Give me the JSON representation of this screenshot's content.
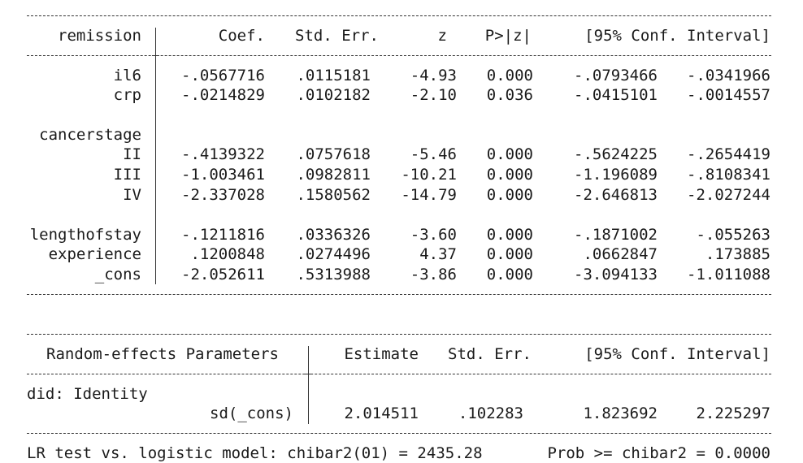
{
  "fixed": {
    "header": {
      "depvar": "remission",
      "coef": "Coef.",
      "se": "Std. Err.",
      "z": "z",
      "p": "P>|z|",
      "ci": "[95% Conf. Interval]"
    },
    "rows": [
      {
        "name": "il6",
        "coef": "-.0567716",
        "se": ".0115181",
        "z": "-4.93",
        "p": "0.000",
        "lo": "-.0793466",
        "hi": "-.0341966"
      },
      {
        "name": "crp",
        "coef": "-.0214829",
        "se": ".0102182",
        "z": "-2.10",
        "p": "0.036",
        "lo": "-.0415101",
        "hi": "-.0014557"
      },
      {
        "name": "cancerstage",
        "coef": "",
        "se": "",
        "z": "",
        "p": "",
        "lo": "",
        "hi": ""
      },
      {
        "name": "II",
        "coef": "-.4139322",
        "se": ".0757618",
        "z": "-5.46",
        "p": "0.000",
        "lo": "-.5624225",
        "hi": "-.2654419"
      },
      {
        "name": "III",
        "coef": "-1.003461",
        "se": ".0982811",
        "z": "-10.21",
        "p": "0.000",
        "lo": "-1.196089",
        "hi": "-.8108341"
      },
      {
        "name": "IV",
        "coef": "-2.337028",
        "se": ".1580562",
        "z": "-14.79",
        "p": "0.000",
        "lo": "-2.646813",
        "hi": "-2.027244"
      },
      {
        "name": "lengthofstay",
        "coef": "-.1211816",
        "se": ".0336326",
        "z": "-3.60",
        "p": "0.000",
        "lo": "-.1871002",
        "hi": "-.055263"
      },
      {
        "name": "experience",
        "coef": ".1200848",
        "se": ".0274496",
        "z": "4.37",
        "p": "0.000",
        "lo": ".0662847",
        "hi": ".173885"
      },
      {
        "name": "_cons",
        "coef": "-2.052611",
        "se": ".5313988",
        "z": "-3.86",
        "p": "0.000",
        "lo": "-3.094133",
        "hi": "-1.011088"
      }
    ]
  },
  "random": {
    "header": {
      "title": "Random-effects Parameters",
      "estimate": "Estimate",
      "se": "Std. Err.",
      "ci": "[95% Conf. Interval]"
    },
    "group": "did: Identity",
    "row": {
      "name": "sd(_cons)",
      "estimate": "2.014511",
      "se": ".102283",
      "lo": "1.823692",
      "hi": "2.225297"
    }
  },
  "lrtest": {
    "label": "LR test vs. logistic model: chibar2(01) = 2435.28",
    "prob": "Prob >= chibar2 = 0.0000"
  }
}
